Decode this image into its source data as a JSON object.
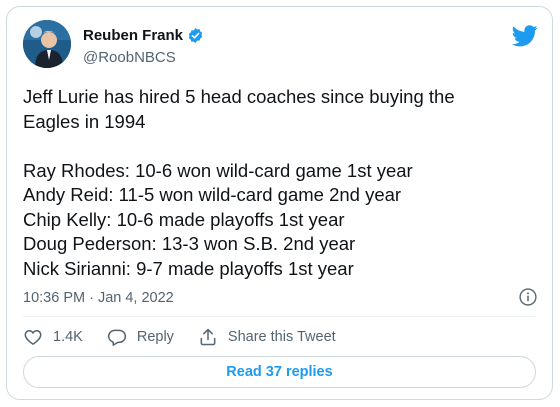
{
  "author": {
    "name": "Reuben Frank",
    "handle": "@RoobNBCS"
  },
  "tweet": {
    "intro": [
      "Jeff Lurie has hired 5 head coaches since buying the",
      "Eagles in 1994"
    ],
    "lines": [
      "Ray Rhodes: 10-6 won wild-card game 1st year",
      "Andy Reid: 11-5 won wild-card game 2nd year",
      "Chip Kelly: 10-6 made playoffs 1st year",
      "Doug Pederson: 13-3 won S.B. 2nd year",
      "Nick Sirianni: 9-7 made playoffs 1st year"
    ],
    "timestamp": "10:36 PM · Jan 4, 2022"
  },
  "actions": {
    "likes": "1.4K",
    "reply_label": "Reply",
    "share_label": "Share this Tweet"
  },
  "read_replies_label": "Read 37 replies",
  "icons": {
    "verified": "verified-badge-icon",
    "brand": "twitter-bird-icon",
    "info": "info-icon",
    "like": "heart-icon",
    "reply": "reply-bubble-icon",
    "share": "share-upload-icon"
  },
  "colors": {
    "accent": "#1d9bf0",
    "text": "#0f1419",
    "muted": "#536471",
    "border": "#cfd9de"
  }
}
